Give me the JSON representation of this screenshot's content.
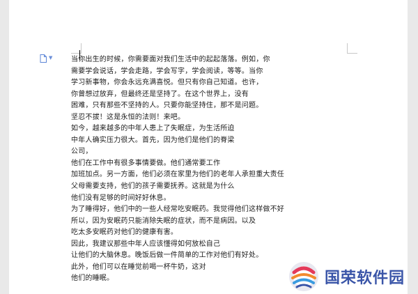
{
  "document": {
    "lines": [
      "当你出生的时候，你需要面对我们生活中的起起落落。例如，你",
      "需要学会说话，学会走路，学会写字，学会阅读，等等。当你",
      "学习新事物，你会永远充满喜悦。但只有你自己知道。也许，",
      "你曾想过放弃，但最终还是坚持了。在这个世界上，没有",
      "困难，只有那些不坚持的人。只要你能坚持住，那不是问题。",
      "坚忍不拔！这是永恒的法则！来吧。",
      "如今，越来越多的中年人患上了失眠症，为生活所迫",
      "中年人确实压力很大。首先，因为他们是他们的脊梁",
      "公司，",
      "他们在工作中有很多事情要做。他们通常要工作",
      "加班加点。另一方面，他们必须在家里为他们的老年人承担重大责任",
      "父母需要支持，他们的孩子需要抚养。这就是为什么",
      "他们没有足够的时间好好休息。",
      "为了睡得好，他们中的一些人经常吃安眠药。我觉得他们这样做不好",
      "所以，因为安眠药只能消除失眠的症状，而不是病因。以及",
      "吃太多安眠药对他们的健康有害。",
      "因此，我建议那些中年人应该懂得如何放松自己",
      "让他们的大脑休息。晚饭后做一件简单的工作对他们有好处。",
      "此外，他们可以在睡觉前喝一杯牛奶，这对",
      "他们的睡眠。"
    ]
  },
  "watermark": {
    "brand": "国荣软件园",
    "brand_color": "#3a55a8"
  },
  "icons": {
    "doc_icon": "document-icon",
    "caret": "chevron-down-icon"
  }
}
